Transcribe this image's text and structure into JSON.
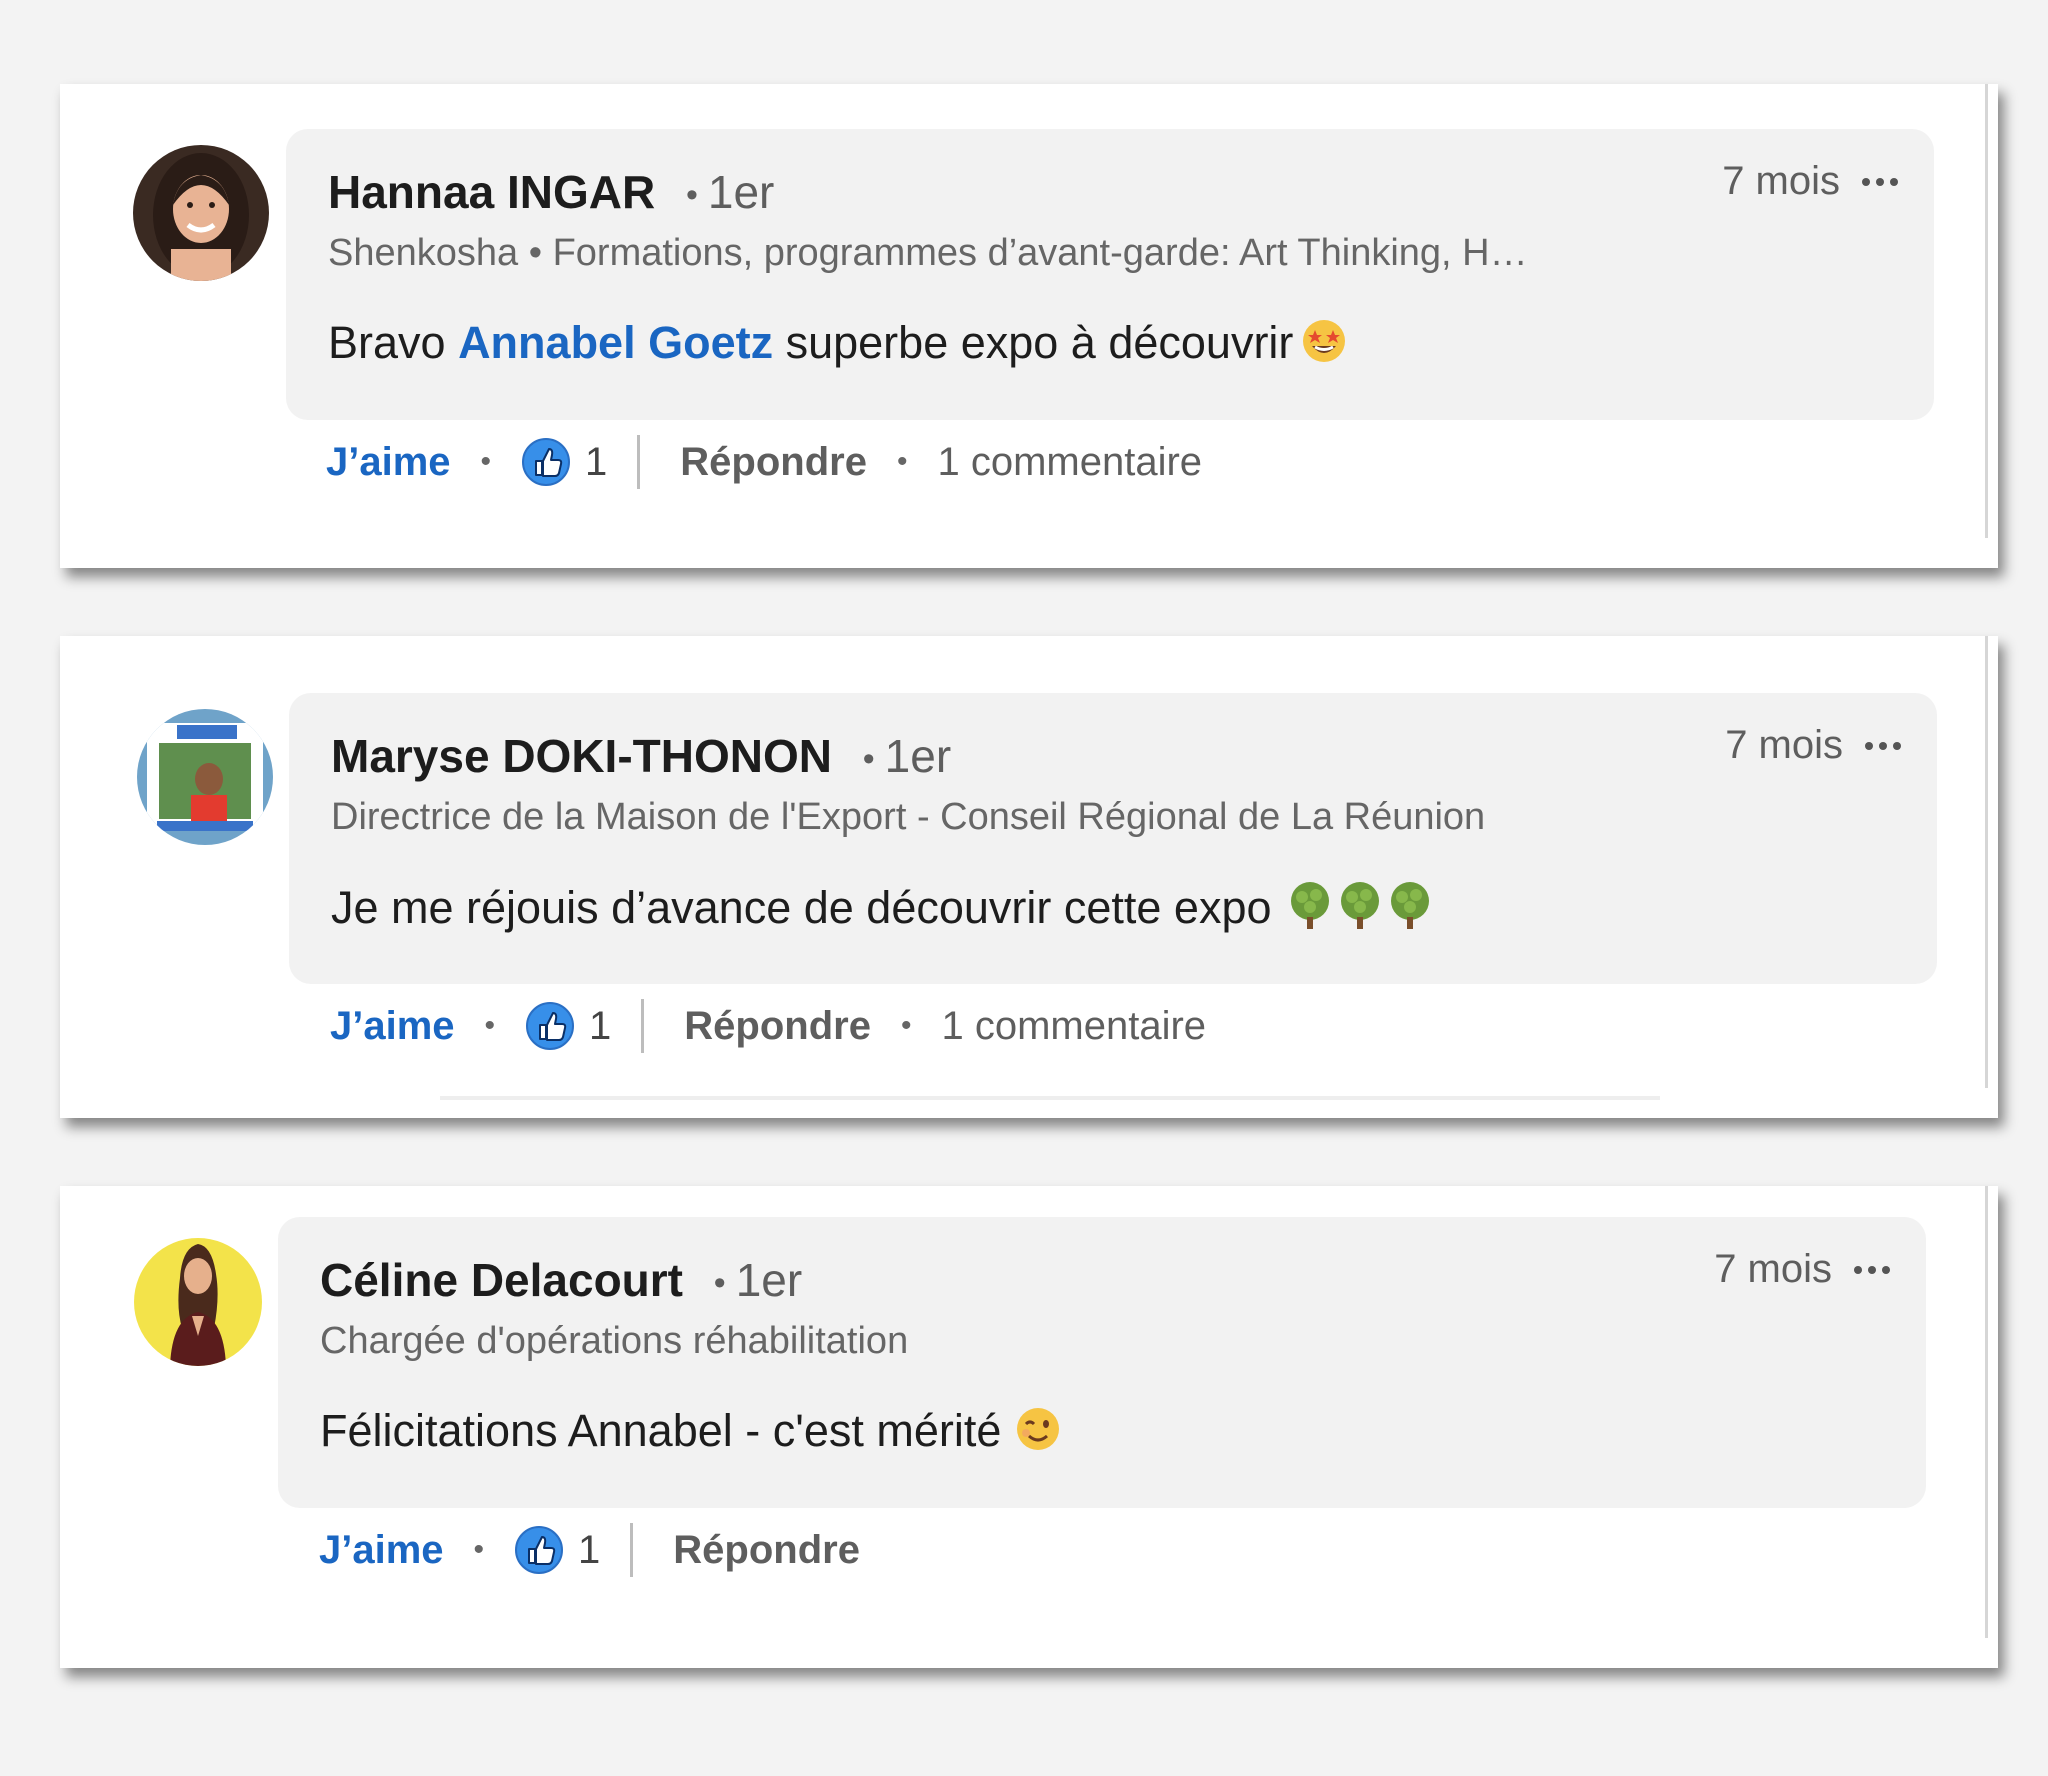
{
  "comments": [
    {
      "author": "Hannaa INGAR",
      "degree": "1er",
      "headline": "Shenkosha • Formations, programmes d’avant-garde: Art Thinking, H…",
      "text_before": "Bravo ",
      "mention": "Annabel Goetz",
      "text_after": " superbe expo à découvrir",
      "emoji": "star-struck-emoji",
      "time": "7 mois",
      "like_label": "J’aime",
      "reaction_count": "1",
      "reply_label": "Répondre",
      "comments_label": "1 commentaire"
    },
    {
      "author": "Maryse DOKI-THONON",
      "degree": "1er",
      "headline": "Directrice de la Maison de l'Export - Conseil Régional de La Réunion",
      "text": "Je me réjouis d’avance de découvrir cette expo",
      "emoji": "tree-emoji",
      "time": "7 mois",
      "like_label": "J’aime",
      "reaction_count": "1",
      "reply_label": "Répondre",
      "comments_label": "1 commentaire"
    },
    {
      "author": "Céline Delacourt",
      "degree": "1er",
      "headline": "Chargée d'opérations réhabilitation",
      "text": "Félicitations Annabel - c'est mérité",
      "emoji": "winking-face-emoji",
      "time": "7 mois",
      "like_label": "J’aime",
      "reaction_count": "1",
      "reply_label": "Répondre"
    }
  ],
  "colors": {
    "link_blue": "#1a66c2",
    "bubble_bg": "#f2f2f2",
    "page_bg": "#f3f3f3",
    "muted_text": "#5e5e5e"
  },
  "icons": [
    "more-options-icon",
    "like-reaction-icon"
  ]
}
